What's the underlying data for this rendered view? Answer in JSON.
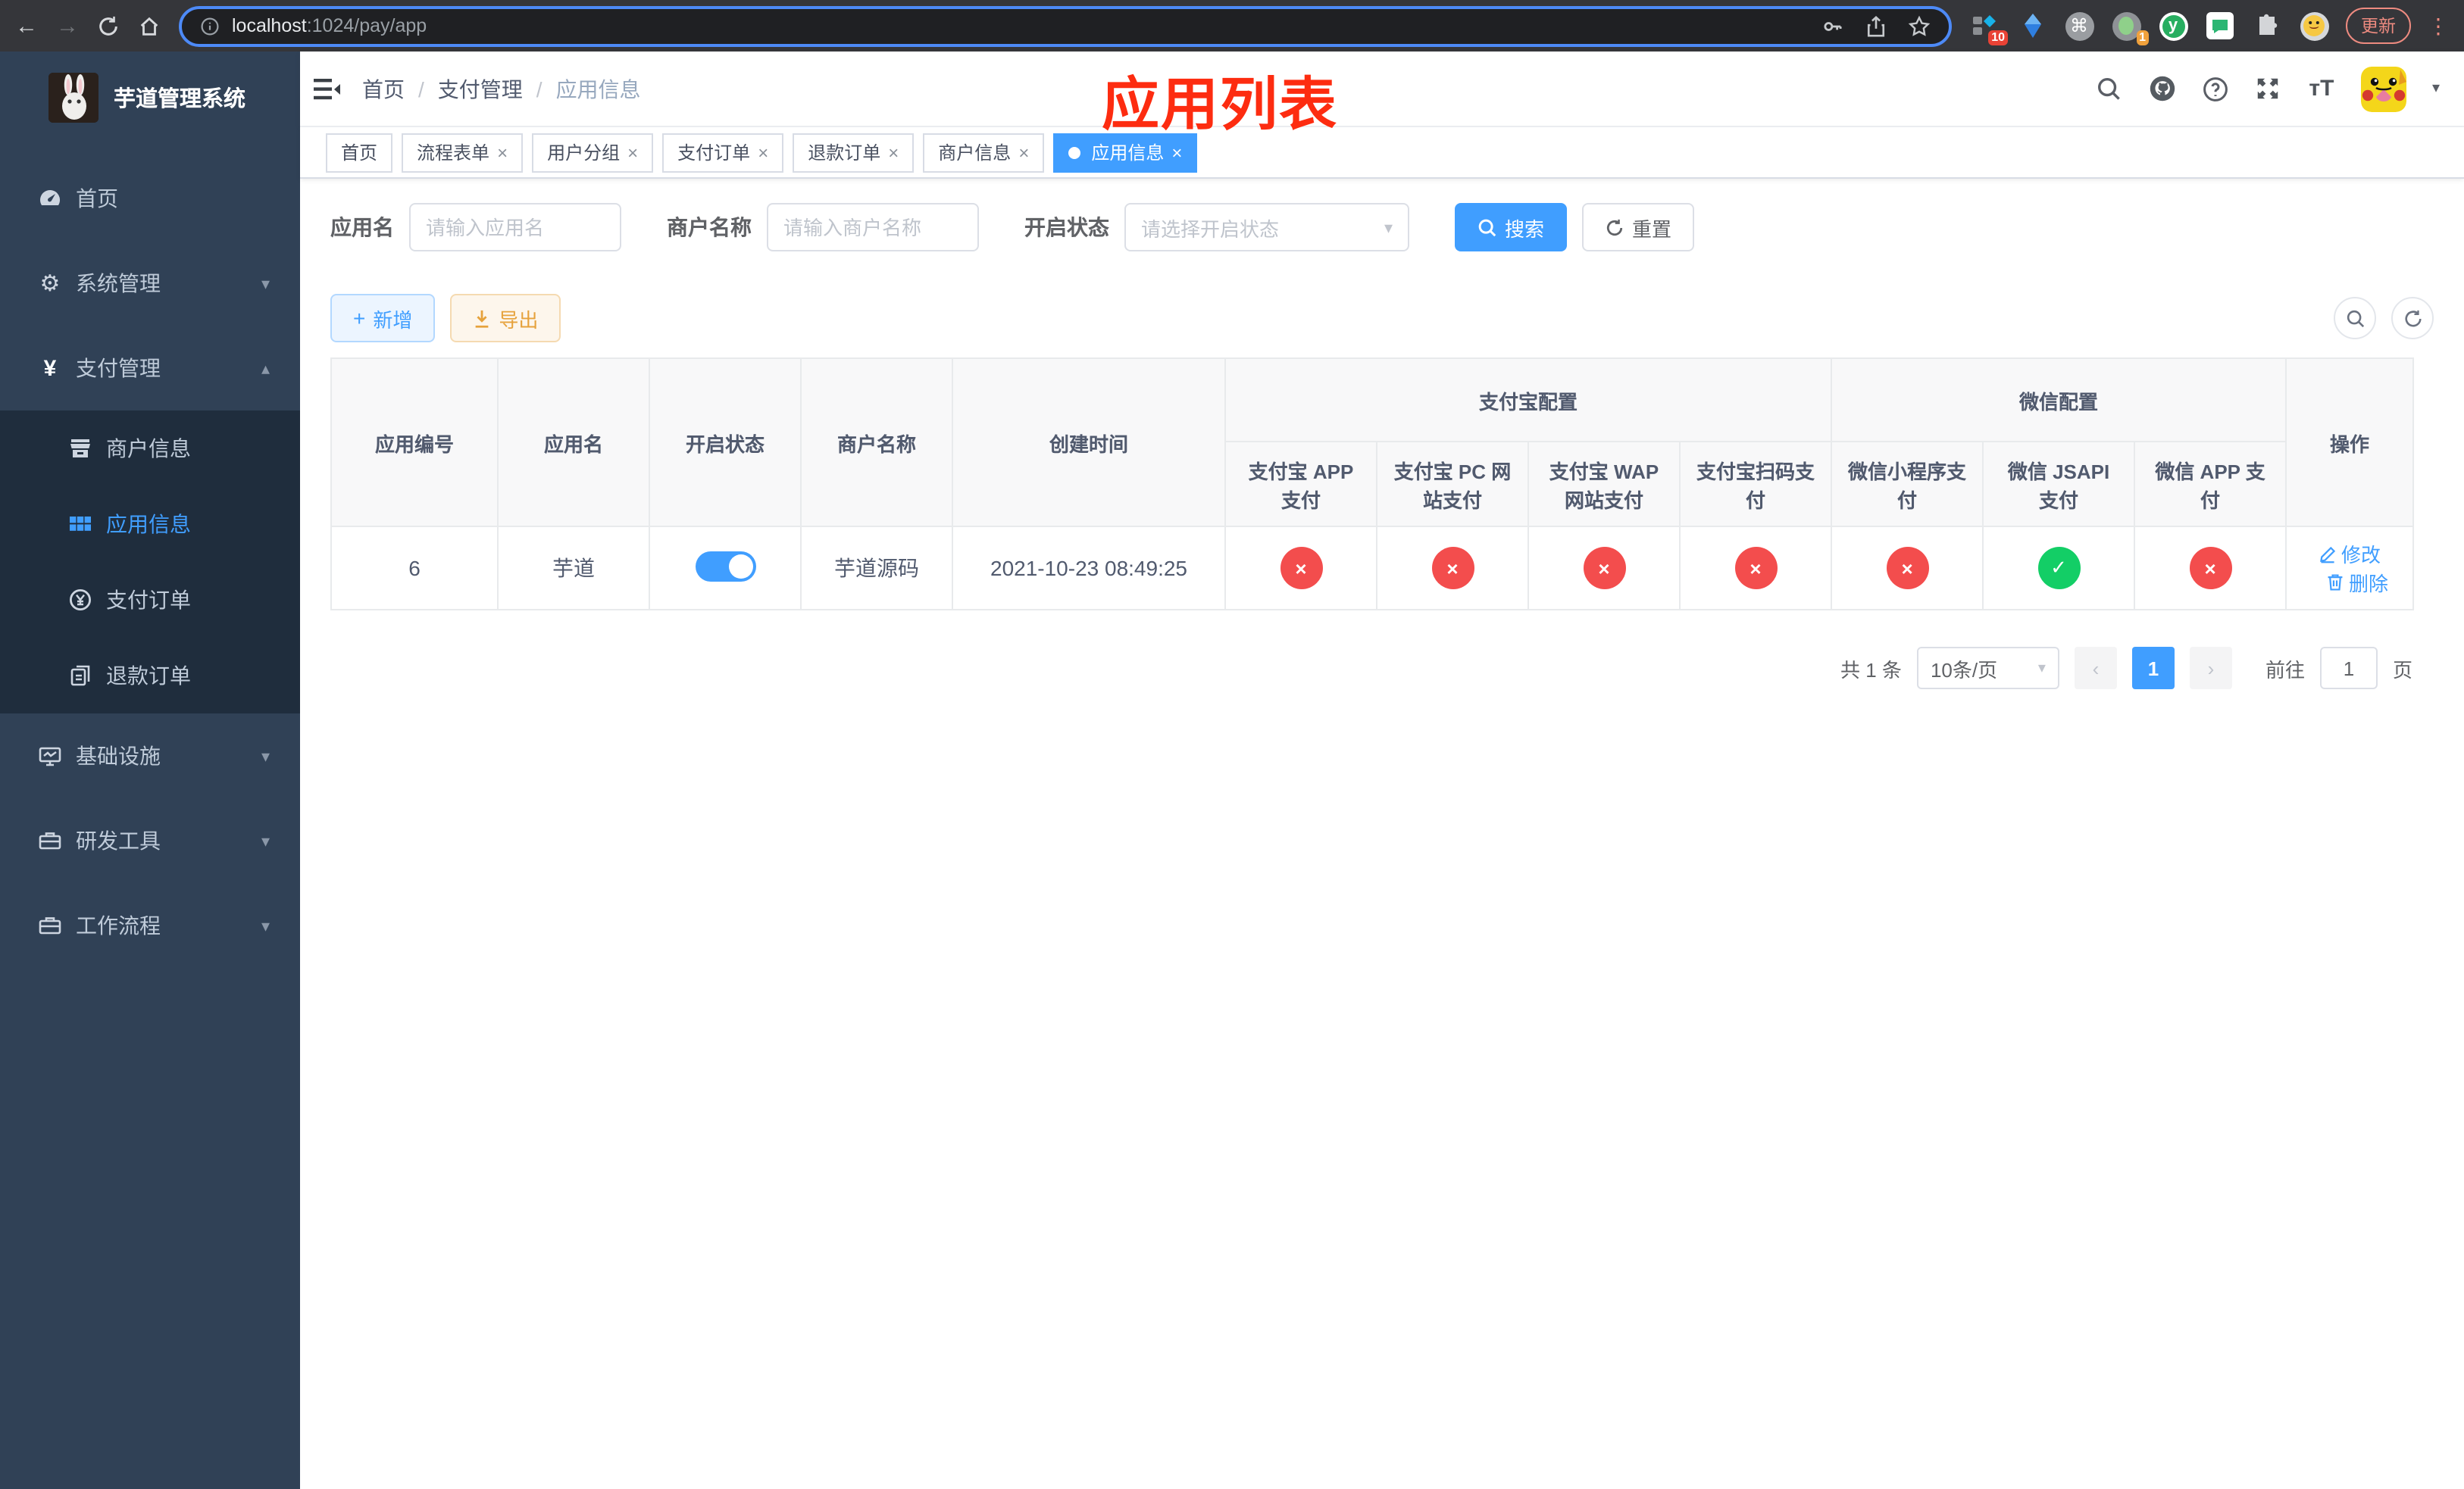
{
  "colors": {
    "accent": "#409eff",
    "success": "#13ce66",
    "danger": "#f34d4d",
    "warning": "#e6a23c",
    "annotation_red": "#fd2c10",
    "sidebar_bg": "#304156",
    "submenu_bg": "#1f2d3d"
  },
  "browser": {
    "url_host": "localhost",
    "url_path": ":1024/pay/app",
    "update_label": "更新",
    "ext1_badge": "10",
    "ext2_badge": "1"
  },
  "sidebar": {
    "title": "芋道管理系统",
    "items": [
      {
        "label": "首页"
      },
      {
        "label": "系统管理"
      },
      {
        "label": "支付管理"
      },
      {
        "label": "商户信息"
      },
      {
        "label": "应用信息"
      },
      {
        "label": "支付订单"
      },
      {
        "label": "退款订单"
      },
      {
        "label": "基础设施"
      },
      {
        "label": "研发工具"
      },
      {
        "label": "工作流程"
      }
    ]
  },
  "breadcrumb": {
    "items": [
      "首页",
      "支付管理",
      "应用信息"
    ],
    "separator": "/"
  },
  "annotation": "应用列表",
  "tabs": [
    {
      "label": "首页",
      "closable": false,
      "active": false
    },
    {
      "label": "流程表单",
      "closable": true,
      "active": false
    },
    {
      "label": "用户分组",
      "closable": true,
      "active": false
    },
    {
      "label": "支付订单",
      "closable": true,
      "active": false
    },
    {
      "label": "退款订单",
      "closable": true,
      "active": false
    },
    {
      "label": "商户信息",
      "closable": true,
      "active": false
    },
    {
      "label": "应用信息",
      "closable": true,
      "active": true
    }
  ],
  "filters": {
    "app_name_label": "应用名",
    "app_name_placeholder": "请输入应用名",
    "merchant_label": "商户名称",
    "merchant_placeholder": "请输入商户名称",
    "status_label": "开启状态",
    "status_placeholder": "请选择开启状态",
    "search_label": "搜索",
    "reset_label": "重置"
  },
  "toolbar": {
    "add_label": "新增",
    "export_label": "导出"
  },
  "table": {
    "headers": {
      "app_id": "应用编号",
      "app_name": "应用名",
      "status": "开启状态",
      "merchant": "商户名称",
      "created": "创建时间",
      "alipay_group": "支付宝配置",
      "wechat_group": "微信配置",
      "actions": "操作",
      "sub": [
        "支付宝 APP 支付",
        "支付宝 PC 网站支付",
        "支付宝 WAP 网站支付",
        "支付宝扫码支付",
        "微信小程序支付",
        "微信 JSAPI 支付",
        "微信 APP 支付"
      ]
    },
    "row": {
      "app_id": "6",
      "app_name": "芋道",
      "enabled": true,
      "merchant": "芋道源码",
      "created": "2021-10-23 08:49:25",
      "statuses": [
        "off",
        "off",
        "off",
        "off",
        "off",
        "on",
        "off"
      ],
      "edit_label": "修改",
      "delete_label": "删除"
    }
  },
  "pagination": {
    "total": "共 1 条",
    "page_size": "10条/页",
    "current_page": "1",
    "goto_prefix": "前往",
    "goto_value": "1",
    "goto_suffix": "页"
  }
}
